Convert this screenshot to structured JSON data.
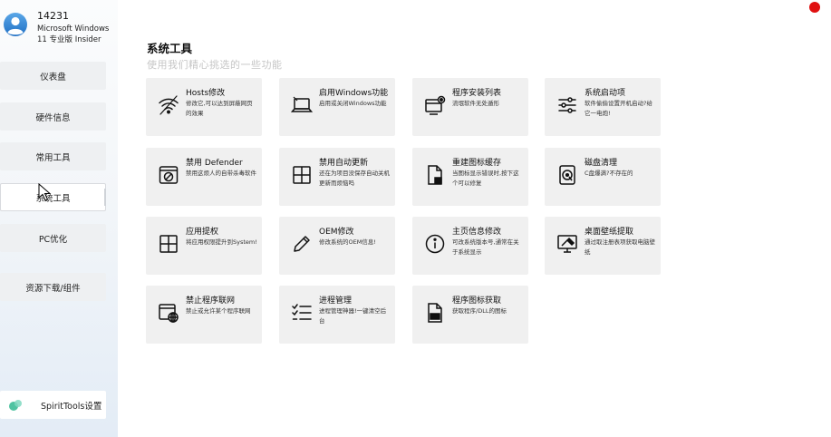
{
  "user": {
    "id": "14231",
    "os": "Microsoft Windows 11 专业版 Insider"
  },
  "sidebar": {
    "items": [
      {
        "label": "仪表盘"
      },
      {
        "label": "硬件信息"
      },
      {
        "label": "常用工具"
      },
      {
        "label": "系统工具",
        "active": true
      },
      {
        "label": "PC优化"
      },
      {
        "label": "资源下载/组件"
      }
    ],
    "settings_label": "SpiritTools设置"
  },
  "main": {
    "title": "系统工具",
    "subtitle": "使用我们精心挑选的一些功能",
    "tiles": [
      {
        "icon": "wifi-icon",
        "title": "Hosts修改",
        "desc": "修改它,可以达到屏蔽网页的效果"
      },
      {
        "icon": "laptop-icon",
        "title": "启用Windows功能",
        "desc": "启用或关闭Windows功能"
      },
      {
        "icon": "program-settings-icon",
        "title": "程序安装列表",
        "desc": "流氓软件无处遁形"
      },
      {
        "icon": "sliders-icon",
        "title": "系统启动项",
        "desc": "软件偷偷设置开机启动?给它一电炮!"
      },
      {
        "icon": "defender-icon",
        "title": "禁用 Defender",
        "desc": "禁用这烦人的自带杀毒软件"
      },
      {
        "icon": "windows-icon",
        "title": "禁用自动更新",
        "desc": "还在为项目没保存自动关机更新而烦恼吗"
      },
      {
        "icon": "file-repair-icon",
        "title": "重建图标缓存",
        "desc": "当图标显示错误时,按下这个可以修复"
      },
      {
        "icon": "disk-icon",
        "title": "磁盘清理",
        "desc": "C盘爆满?不存在的"
      },
      {
        "icon": "windows-icon",
        "title": "应用提权",
        "desc": "将应用权限提升到System!"
      },
      {
        "icon": "pencil-icon",
        "title": "OEM修改",
        "desc": "修改系统的OEM信息!"
      },
      {
        "icon": "info-icon",
        "title": "主页信息修改",
        "desc": "可改系统版本号,通常在关于系统显示"
      },
      {
        "icon": "wallpaper-icon",
        "title": "桌面壁纸提取",
        "desc": "通过取注册表项获取电脑壁纸"
      },
      {
        "icon": "no-network-icon",
        "title": "禁止程序联网",
        "desc": "禁止或允许某个程序联网"
      },
      {
        "icon": "checklist-icon",
        "title": "进程管理",
        "desc": "进程管理神器!一键清空后台"
      },
      {
        "icon": "dll-file-icon",
        "title": "程序图标获取",
        "desc": "获取程序/DLL的图标"
      }
    ]
  },
  "colors": {
    "tile_bg": "#f0f0f0",
    "record_dot": "#e01010",
    "subtitle": "#c6c6c6"
  }
}
